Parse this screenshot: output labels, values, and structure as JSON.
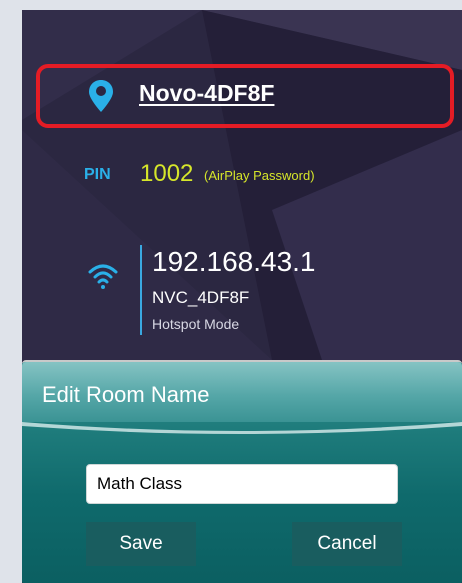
{
  "device": {
    "name": "Novo-4DF8F",
    "pin_label": "PIN",
    "pin_value": "1002",
    "pin_note": "(AirPlay Password)",
    "ip": "192.168.43.1",
    "ssid": "NVC_4DF8F",
    "mode": "Hotspot Mode"
  },
  "icons": {
    "location": "location-pin-icon",
    "wifi": "wifi-icon"
  },
  "dialog": {
    "title": "Edit Room Name",
    "input_value": "Math Class",
    "save_label": "Save",
    "cancel_label": "Cancel"
  },
  "colors": {
    "highlight_border": "#e41c25",
    "pin_label": "#2ab0e8",
    "pin_value": "#d6e62a",
    "panel_bg": "#2b2741",
    "dialog_teal": "#0f6a6c",
    "button_bg": "#195d5f"
  }
}
